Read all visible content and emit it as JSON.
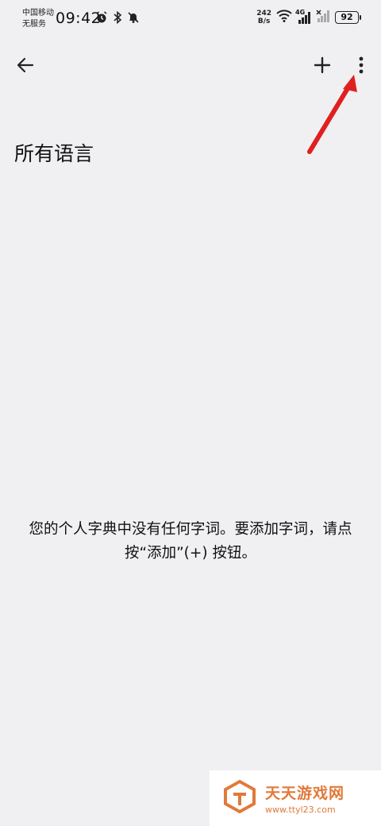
{
  "status_bar": {
    "carrier_line1": "中国移动",
    "carrier_line2": "无服务",
    "time": "09:42",
    "speed_value": "242",
    "speed_unit": "B/s",
    "network_label": "4G",
    "battery": "92",
    "icons": [
      "alarm-icon",
      "bluetooth-icon",
      "mute-bell-icon",
      "wifi-icon",
      "signal-icon",
      "no-signal-icon"
    ]
  },
  "app_bar": {
    "back_icon": "arrow-left-icon",
    "add_icon": "plus-icon",
    "more_icon": "more-vertical-icon"
  },
  "page": {
    "title": "所有语言",
    "empty_message": "您的个人字典中没有任何字词。要添加字词，请点按“添加”(+) 按钮。"
  },
  "watermark": {
    "title": "天天游戏网",
    "url": "www.ttyl23.com"
  },
  "colors": {
    "background": "#f0f0f2",
    "annotation_arrow": "#e02020",
    "watermark": "#e07a3a"
  }
}
